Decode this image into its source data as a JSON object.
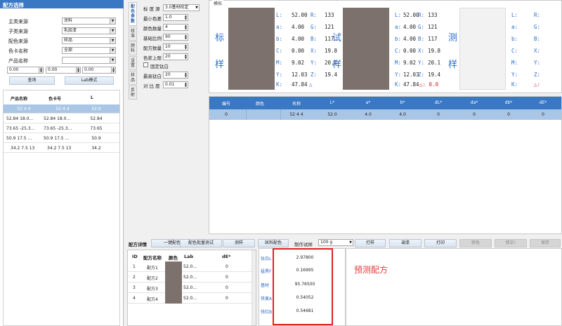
{
  "left": {
    "title": "配方选择",
    "filters": [
      {
        "label": "主类来源",
        "value": "涂料"
      },
      {
        "label": "子类来源",
        "value": "乳胶漆"
      },
      {
        "label": "配色来源",
        "value": "样品"
      },
      {
        "label": "色卡名称",
        "value": "全部"
      },
      {
        "label": "产品名称",
        "value": ""
      }
    ],
    "lab_inputs": [
      "0.00",
      "0.00",
      "0.00"
    ],
    "query_button": "查询",
    "lab_mode_button": "Lab模式",
    "table_headers": [
      "产品名称",
      "色卡号",
      "L"
    ],
    "rows": [
      [
        "52 4 4",
        "52 4 4",
        "52.0"
      ],
      [
        "52.84 18.0...",
        "52.84 18.0...",
        "52.84"
      ],
      [
        "73.65 -25.3...",
        "73.65 -25.3...",
        "73.65"
      ],
      [
        "50.9 17.5 ...",
        "50.9 17.5 ...",
        "50.9"
      ],
      [
        "34.2 7.5 13",
        "34.2 7.5 13",
        "34.2"
      ]
    ]
  },
  "vtabs": [
    "配色参数",
    "校准",
    "颜料",
    "设置",
    "样品",
    "反射"
  ],
  "params": {
    "rows": [
      {
        "label": "标 度 源",
        "value": "3.0基材校定"
      },
      {
        "label": "最小色差",
        "value": "1.0"
      },
      {
        "label": "颜色数量",
        "value": "4"
      },
      {
        "label": "基础比例",
        "value": "90"
      },
      {
        "label": "配方数量",
        "value": "10"
      },
      {
        "label": "色浆上限",
        "value": "20"
      }
    ],
    "checkbox_label": "固定钛白",
    "lower_rows": [
      {
        "label": "最高钛白",
        "value": "20"
      },
      {
        "label": "对 比 度",
        "value": "0.01"
      }
    ]
  },
  "samples": {
    "group_title": "模拟",
    "standard": {
      "chars": [
        "标",
        "样"
      ],
      "lines": [
        {
          "k1": "L:",
          "v1": "52.00",
          "k2": "R:",
          "v2": "133"
        },
        {
          "k1": "a:",
          "v1": "4.00",
          "k2": "G:",
          "v2": "121"
        },
        {
          "k1": "b:",
          "v1": "4.00",
          "k2": "B:",
          "v2": "117"
        },
        {
          "k1": "C:",
          "v1": "0.00",
          "k2": "X:",
          "v2": "19.8"
        },
        {
          "k1": "M:",
          "v1": "9.02",
          "k2": "Y:",
          "v2": "20.1"
        },
        {
          "k1": "Y:",
          "v1": "12.03",
          "k2": "Z:",
          "v2": "19.4"
        },
        {
          "k1": "K:",
          "v1": "47.84",
          "k2": "",
          "v2": ""
        }
      ],
      "delta": "△"
    },
    "trial": {
      "chars": [
        "试",
        "样"
      ],
      "lines": [
        {
          "k1": "L:",
          "v1": "52.00",
          "k2": "R:",
          "v2": "133"
        },
        {
          "k1": "a:",
          "v1": "4.00",
          "k2": "G:",
          "v2": "121"
        },
        {
          "k1": "b:",
          "v1": "4.00",
          "k2": "B:",
          "v2": "117"
        },
        {
          "k1": "C:",
          "v1": "0.00",
          "k2": "X:",
          "v2": "19.8"
        },
        {
          "k1": "M:",
          "v1": "9.02",
          "k2": "Y:",
          "v2": "20.1"
        },
        {
          "k1": "Y:",
          "v1": "12.03",
          "k2": "Z:",
          "v2": "19.4"
        },
        {
          "k1": "K:",
          "v1": "47.84",
          "k2": "",
          "v2": ""
        }
      ],
      "delta": "△: 0.0"
    },
    "measured": {
      "chars": [
        "测",
        "样"
      ],
      "keys": [
        "L:",
        "a:",
        "b:",
        "C:",
        "M:",
        "Y:",
        "K:"
      ],
      "keys2": [
        "R:",
        "G:",
        "B:",
        "X:",
        "Y:",
        "Z:"
      ],
      "delta": "△:"
    }
  },
  "result": {
    "headers": [
      "编号",
      "颜色",
      "名称",
      "L*",
      "a*",
      "b*",
      "dL*",
      "da*",
      "db*",
      "dE*"
    ],
    "row": [
      "0",
      "",
      "52 4 4",
      "52.0",
      "4.0",
      "4.0",
      "0",
      "0",
      "0",
      "0"
    ]
  },
  "toolbar": {
    "section_label": "配方详情",
    "buttons": [
      "一键配色",
      "配色批量测试",
      "测样",
      "匡料配色"
    ],
    "sample_label": "制作试样",
    "sample_value": "100 g",
    "buttons2": [
      "打样",
      "调漆",
      "打印"
    ],
    "disabled_buttons": [
      "修色",
      "修正!",
      "保存"
    ]
  },
  "detail": {
    "headers": [
      "ID",
      "配方名称",
      "颜色",
      "Lab",
      "dE*"
    ],
    "rows": [
      {
        "id": "1",
        "name": "配方1",
        "lab": "52.0...",
        "de": "0"
      },
      {
        "id": "2",
        "name": "配方2",
        "lab": "52.0...",
        "de": "0"
      },
      {
        "id": "3",
        "name": "配方3",
        "lab": "52.0...",
        "de": "0"
      },
      {
        "id": "4",
        "name": "配方4",
        "lab": "52.0...",
        "de": "0"
      }
    ]
  },
  "prediction": {
    "items": [
      {
        "name": "钛白L",
        "value": "2.97800"
      },
      {
        "name": "猛黑F",
        "value": "0.16995"
      },
      {
        "name": "基材",
        "value": "95.76500"
      },
      {
        "name": "铁黄A",
        "value": "0.54052"
      },
      {
        "name": "铁红B",
        "value": "0.54681"
      }
    ],
    "annotation": "预测配方"
  },
  "colors": {
    "accent": "#3a78c3",
    "selected": "#a9c6e6",
    "swatch": "#7d716d",
    "highlight": "#e02020"
  }
}
